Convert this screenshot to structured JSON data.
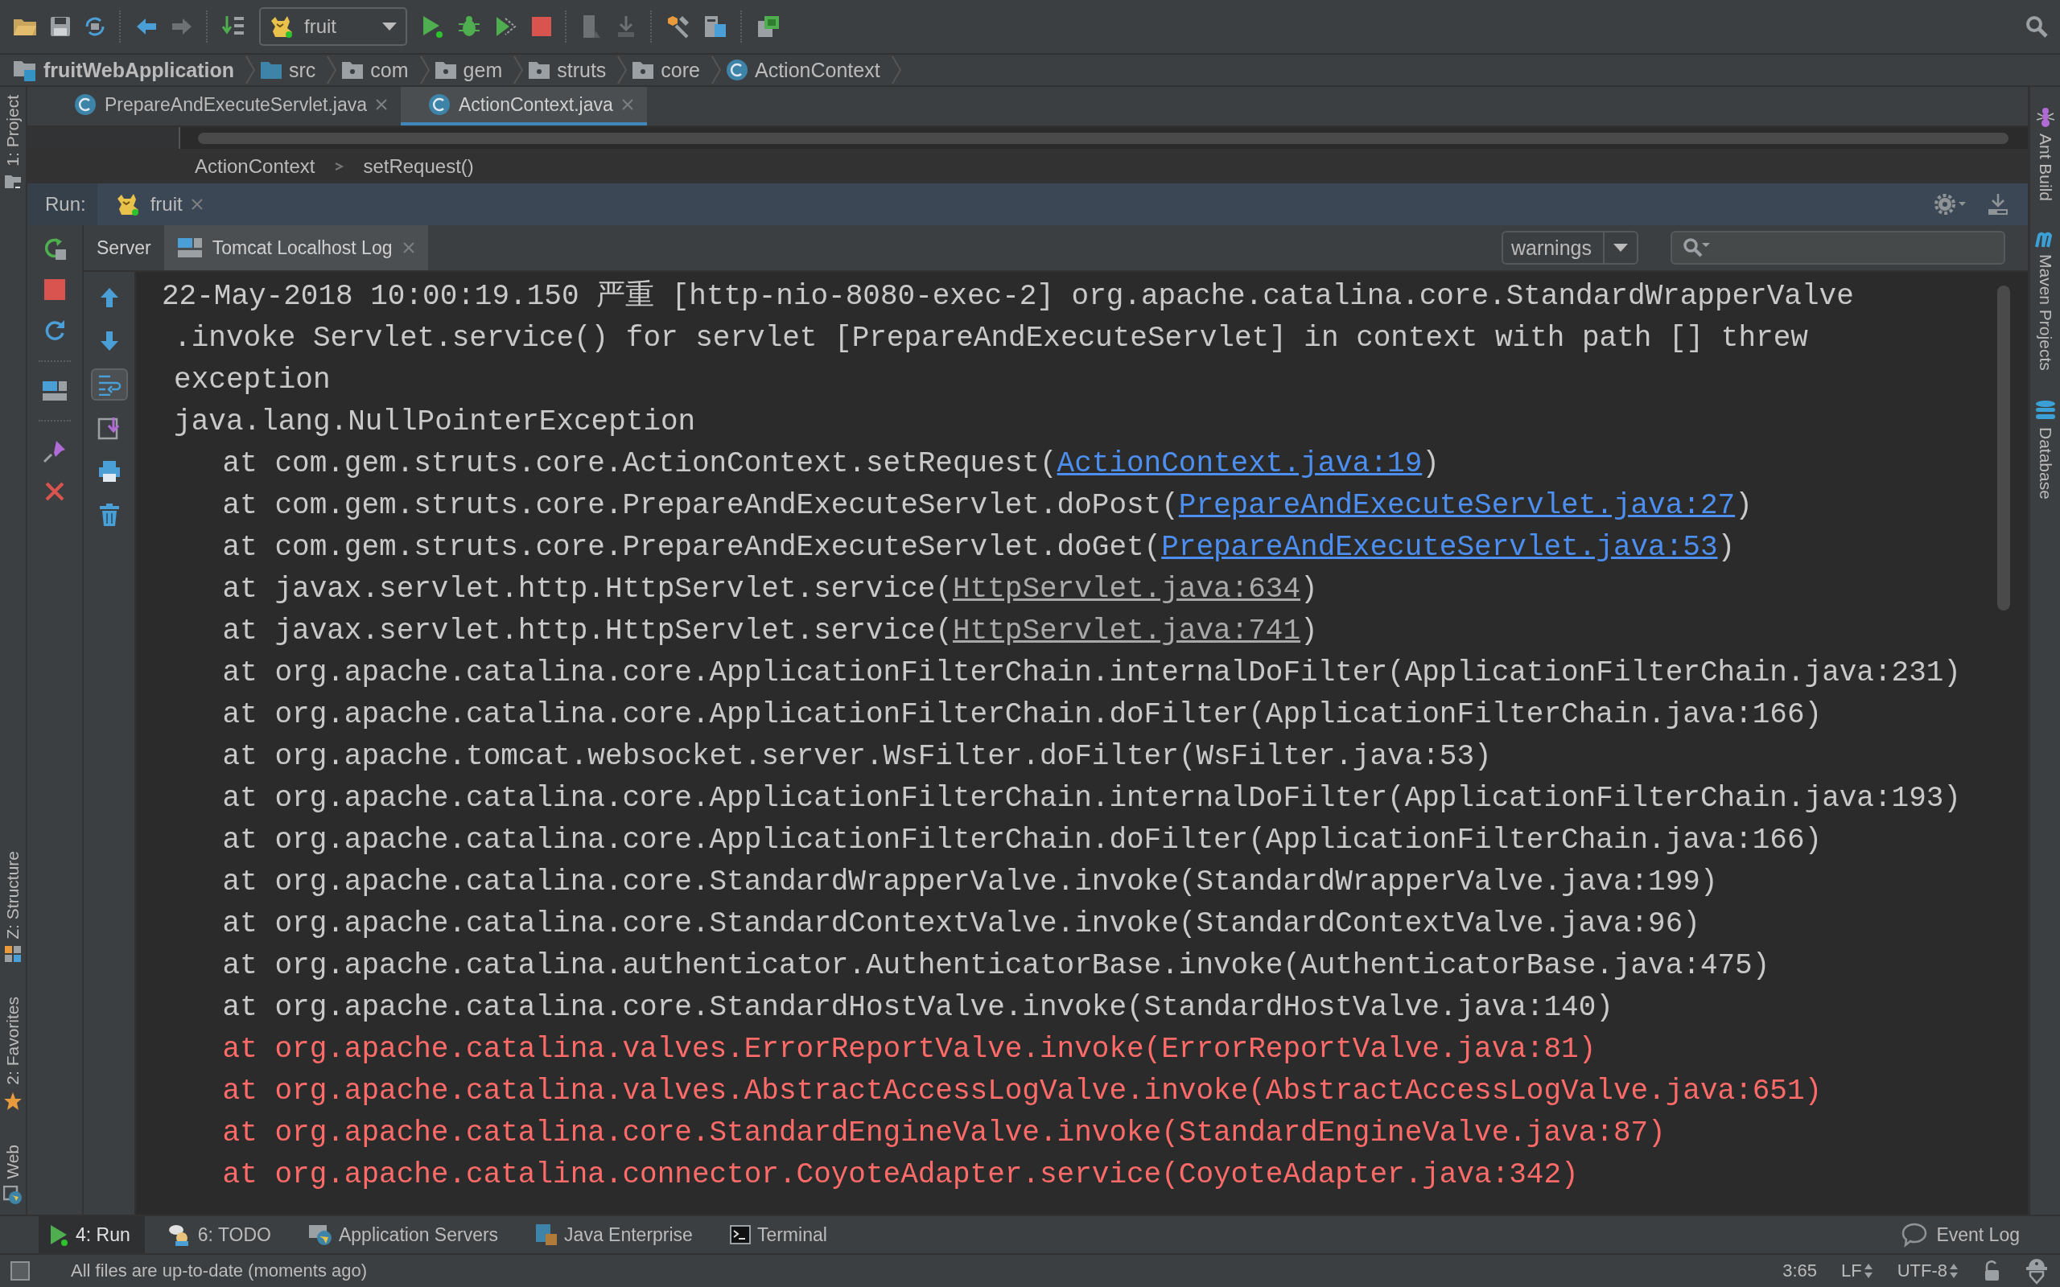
{
  "toolbar": {
    "run_config": "fruit"
  },
  "navigation": [
    {
      "label": "fruitWebApplication",
      "kind": "module"
    },
    {
      "label": "src",
      "kind": "source"
    },
    {
      "label": "com",
      "kind": "package"
    },
    {
      "label": "gem",
      "kind": "package"
    },
    {
      "label": "struts",
      "kind": "package"
    },
    {
      "label": "core",
      "kind": "package"
    },
    {
      "label": "ActionContext",
      "kind": "class"
    }
  ],
  "editor_tabs": [
    {
      "label": "PrepareAndExecuteServlet.java",
      "selected": false
    },
    {
      "label": "ActionContext.java",
      "selected": true
    }
  ],
  "editor_breadcrumb": [
    "ActionContext",
    "setRequest()"
  ],
  "run_panel": {
    "label": "Run:",
    "tab": "fruit",
    "subtabs": [
      {
        "label": "Server",
        "kind": "plain",
        "selected": false
      },
      {
        "label": "Tomcat Localhost Log",
        "kind": "log",
        "selected": true
      }
    ],
    "filter": "warnings",
    "console_toolbar": [
      {
        "kind": "up",
        "on": false
      },
      {
        "kind": "down",
        "on": false
      },
      {
        "kind": "wrap",
        "on": true
      },
      {
        "kind": "scroll",
        "on": false
      },
      {
        "kind": "print",
        "on": false
      },
      {
        "kind": "trash",
        "on": false
      }
    ],
    "console": [
      {
        "kind": "message",
        "text": "22-May-2018 10:00:19.150 严重 [http-nio-8080-exec-2] org.apache.catalina.core.StandardWrapperValve"
      },
      {
        "kind": "wrap",
        "text": ".invoke Servlet.service() for servlet [PrepareAndExecuteServlet] in context with path [] threw"
      },
      {
        "kind": "wrap",
        "text": "exception"
      },
      {
        "kind": "wrap",
        "text": "java.lang.NullPointerException"
      },
      {
        "kind": "frame",
        "text": "at com.gem.struts.core.ActionContext.setRequest(",
        "link": "ActionContext.java:19",
        "in_project": true,
        "tail": ")"
      },
      {
        "kind": "frame",
        "text": "at com.gem.struts.core.PrepareAndExecuteServlet.doPost(",
        "link": "PrepareAndExecuteServlet.java:27",
        "in_project": true,
        "tail": ")"
      },
      {
        "kind": "frame",
        "text": "at com.gem.struts.core.PrepareAndExecuteServlet.doGet(",
        "link": "PrepareAndExecuteServlet.java:53",
        "in_project": true,
        "tail": ")"
      },
      {
        "kind": "frame",
        "text": "at javax.servlet.http.HttpServlet.service(",
        "link": "HttpServlet.java:634",
        "in_project": false,
        "tail": ")"
      },
      {
        "kind": "frame",
        "text": "at javax.servlet.http.HttpServlet.service(",
        "link": "HttpServlet.java:741",
        "in_project": false,
        "tail": ")"
      },
      {
        "kind": "frame",
        "text": "at org.apache.catalina.core.ApplicationFilterChain.internalDoFilter(ApplicationFilterChain.java:231)"
      },
      {
        "kind": "frame",
        "text": "at org.apache.catalina.core.ApplicationFilterChain.doFilter(ApplicationFilterChain.java:166)"
      },
      {
        "kind": "frame",
        "text": "at org.apache.tomcat.websocket.server.WsFilter.doFilter(WsFilter.java:53)"
      },
      {
        "kind": "frame",
        "text": "at org.apache.catalina.core.ApplicationFilterChain.internalDoFilter(ApplicationFilterChain.java:193)"
      },
      {
        "kind": "frame",
        "text": "at org.apache.catalina.core.ApplicationFilterChain.doFilter(ApplicationFilterChain.java:166)"
      },
      {
        "kind": "frame",
        "text": "at org.apache.catalina.core.StandardWrapperValve.invoke(StandardWrapperValve.java:199)"
      },
      {
        "kind": "frame",
        "text": "at org.apache.catalina.core.StandardContextValve.invoke(StandardContextValve.java:96)"
      },
      {
        "kind": "frame",
        "text": "at org.apache.catalina.authenticator.AuthenticatorBase.invoke(AuthenticatorBase.java:475)"
      },
      {
        "kind": "frame",
        "text": "at org.apache.catalina.core.StandardHostValve.invoke(StandardHostValve.java:140)"
      },
      {
        "kind": "error",
        "text": "at org.apache.catalina.valves.ErrorReportValve.invoke(ErrorReportValve.java:81)"
      },
      {
        "kind": "error",
        "text": "at org.apache.catalina.valves.AbstractAccessLogValve.invoke(AbstractAccessLogValve.java:651)"
      },
      {
        "kind": "error",
        "text": "at org.apache.catalina.core.StandardEngineValve.invoke(StandardEngineValve.java:87)"
      },
      {
        "kind": "error",
        "text": "at org.apache.catalina.connector.CoyoteAdapter.service(CoyoteAdapter.java:342)"
      }
    ]
  },
  "left_stripe": {
    "top": [
      {
        "label": "1: Project",
        "kind": "project"
      }
    ],
    "bottom": [
      {
        "label": "Z: Structure",
        "kind": "structure"
      },
      {
        "label": "2: Favorites",
        "kind": "favorites"
      },
      {
        "label": "Web",
        "kind": "web"
      }
    ]
  },
  "right_stripe": [
    {
      "label": "Ant Build",
      "kind": "ant"
    },
    {
      "label": "Maven Projects",
      "kind": "maven"
    },
    {
      "label": "Database",
      "kind": "database"
    }
  ],
  "tool_windows": [
    {
      "label": "4: Run",
      "kind": "run",
      "selected": true
    },
    {
      "label": "6: TODO",
      "kind": "todo",
      "selected": false
    },
    {
      "label": "Application Servers",
      "kind": "servers",
      "selected": false
    },
    {
      "label": "Java Enterprise",
      "kind": "enterprise",
      "selected": false
    },
    {
      "label": "Terminal",
      "kind": "terminal",
      "selected": false
    }
  ],
  "event_log": "Event Log",
  "status_bar": {
    "message": "All files are up-to-date (moments ago)",
    "position": "3:65",
    "line_separator": "LF",
    "encoding": "UTF-8"
  }
}
